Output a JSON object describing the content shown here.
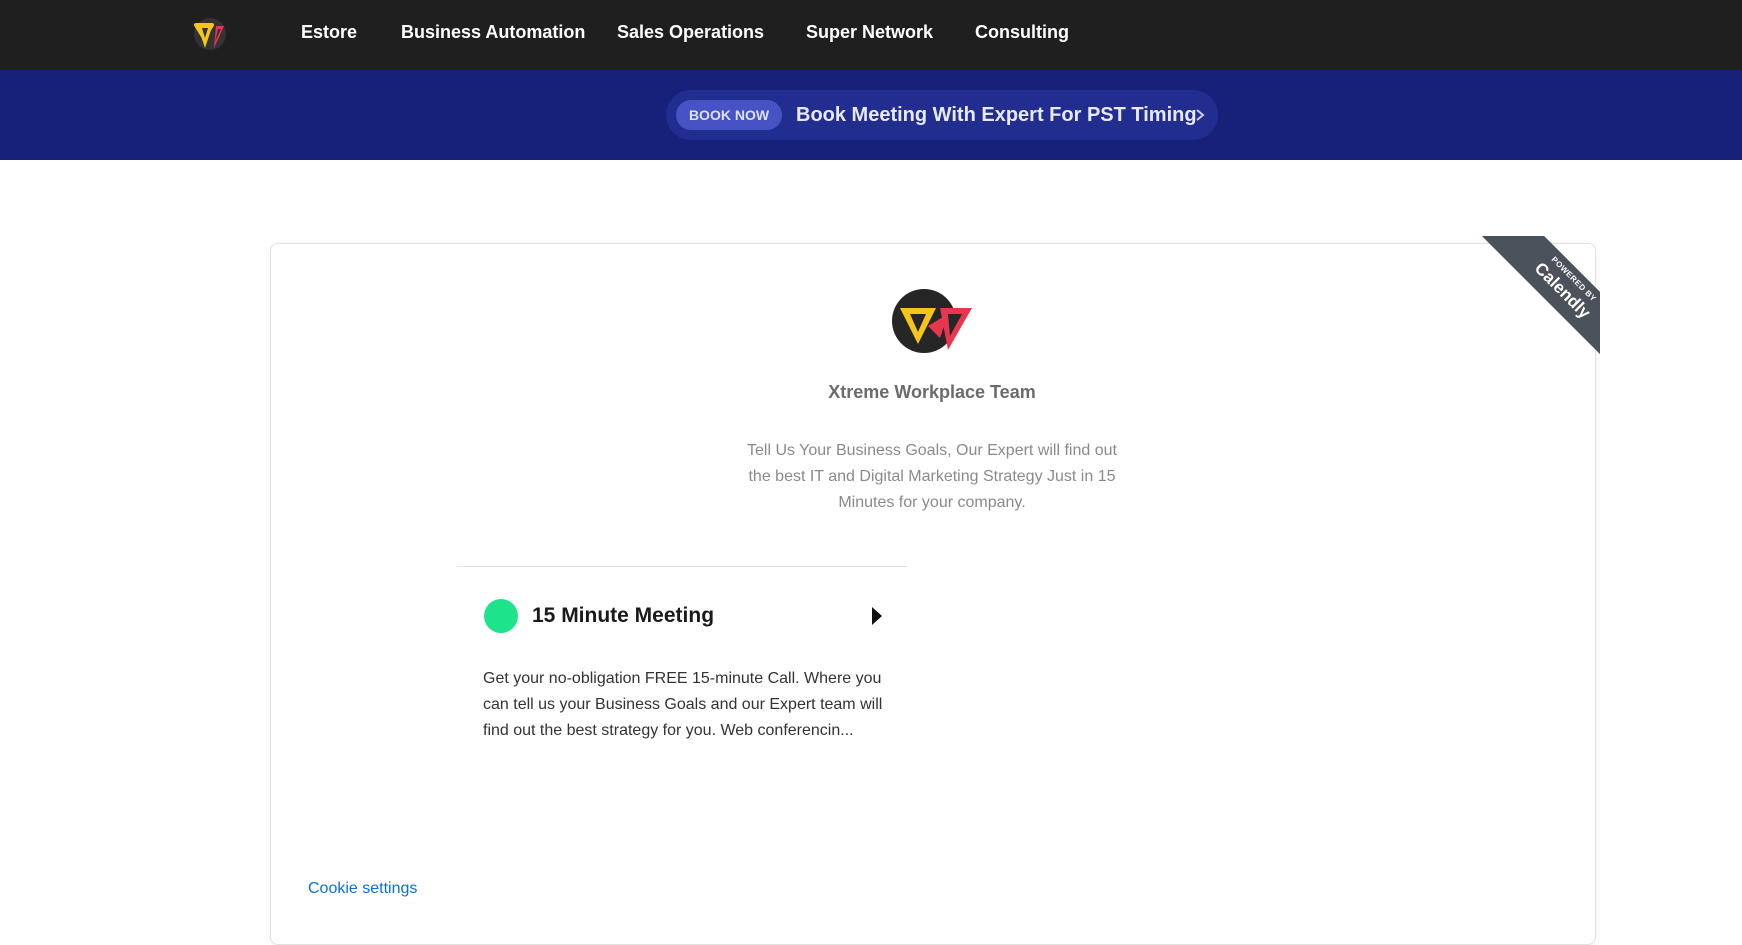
{
  "nav": {
    "logo_icon": "xw-logo-icon",
    "items": [
      "Estore",
      "Business Automation",
      "Sales Operations",
      "Super Network",
      "Consulting"
    ]
  },
  "banner": {
    "badge": "BOOK NOW",
    "text": "Book Meeting With Expert For PST Timing",
    "chevron_icon": "chevron-right-icon"
  },
  "calendly": {
    "ribbon_small": "POWERED BY",
    "ribbon_brand": "Calendly",
    "team_name": "Xtreme Workplace Team",
    "description": "Tell Us Your Business Goals, Our Expert will find out the best IT and Digital Marketing Strategy Just in 15 Minutes for your company.",
    "event": {
      "title": "15 Minute Meeting",
      "color": "#1de38a",
      "description": "Get your no-obligation FREE 15-minute Call. Where you can tell us your Business Goals and our Expert team will find out the best strategy for you. Web conferencin..."
    },
    "cookie_settings": "Cookie settings"
  },
  "colors": {
    "nav_bg": "#1f1f1f",
    "banner_bg": "#17217a",
    "badge_bg": "#4753c4",
    "ribbon_bg": "#4b525b",
    "link": "#0b6fd9",
    "logo_yellow": "#f5c518",
    "logo_red": "#e8364f"
  }
}
